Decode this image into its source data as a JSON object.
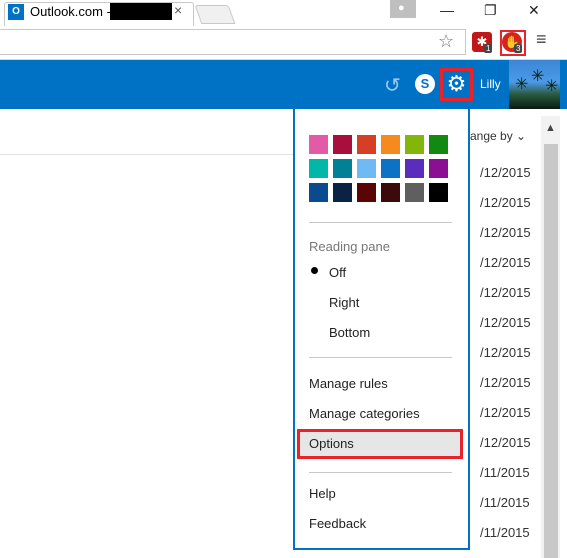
{
  "browser": {
    "tab_title": "Outlook.com -",
    "tab_favicon": "O",
    "tab_close": "×",
    "profile_icon": "person-icon",
    "window_min": "—",
    "window_max": "❐",
    "window_close": "✕",
    "star_icon": "☆",
    "ext1_badge": "1",
    "ext2_badge": "3",
    "menu_icon": "≡"
  },
  "header": {
    "undo_icon": "↺",
    "skype_label": "S",
    "gear_icon": "⚙",
    "user_name": "Lilly"
  },
  "list": {
    "arrange_label": "ange by ⌄",
    "dates": [
      "/12/2015",
      "/12/2015",
      "/12/2015",
      "/12/2015",
      "/12/2015",
      "/12/2015",
      "/12/2015",
      "/12/2015",
      "/12/2015",
      "/12/2015",
      "/11/2015",
      "/11/2015",
      "/11/2015"
    ]
  },
  "settings_menu": {
    "theme_colors": [
      [
        "#e35ba6",
        "#a80f3c",
        "#d63f23",
        "#f58a1f",
        "#82b60b",
        "#128a12"
      ],
      [
        "#00b7a8",
        "#008195",
        "#6fb9f5",
        "#0b72c6",
        "#5b2dbd",
        "#8b0f92"
      ],
      [
        "#0a4a8e",
        "#0a2244",
        "#5a0505",
        "#3c0a0a",
        "#5f5f5f",
        "#000000"
      ]
    ],
    "reading_pane_header": "Reading pane",
    "reading_pane_options": [
      "Off",
      "Right",
      "Bottom"
    ],
    "items": [
      "Manage rules",
      "Manage categories",
      "Options",
      "Help",
      "Feedback"
    ]
  }
}
